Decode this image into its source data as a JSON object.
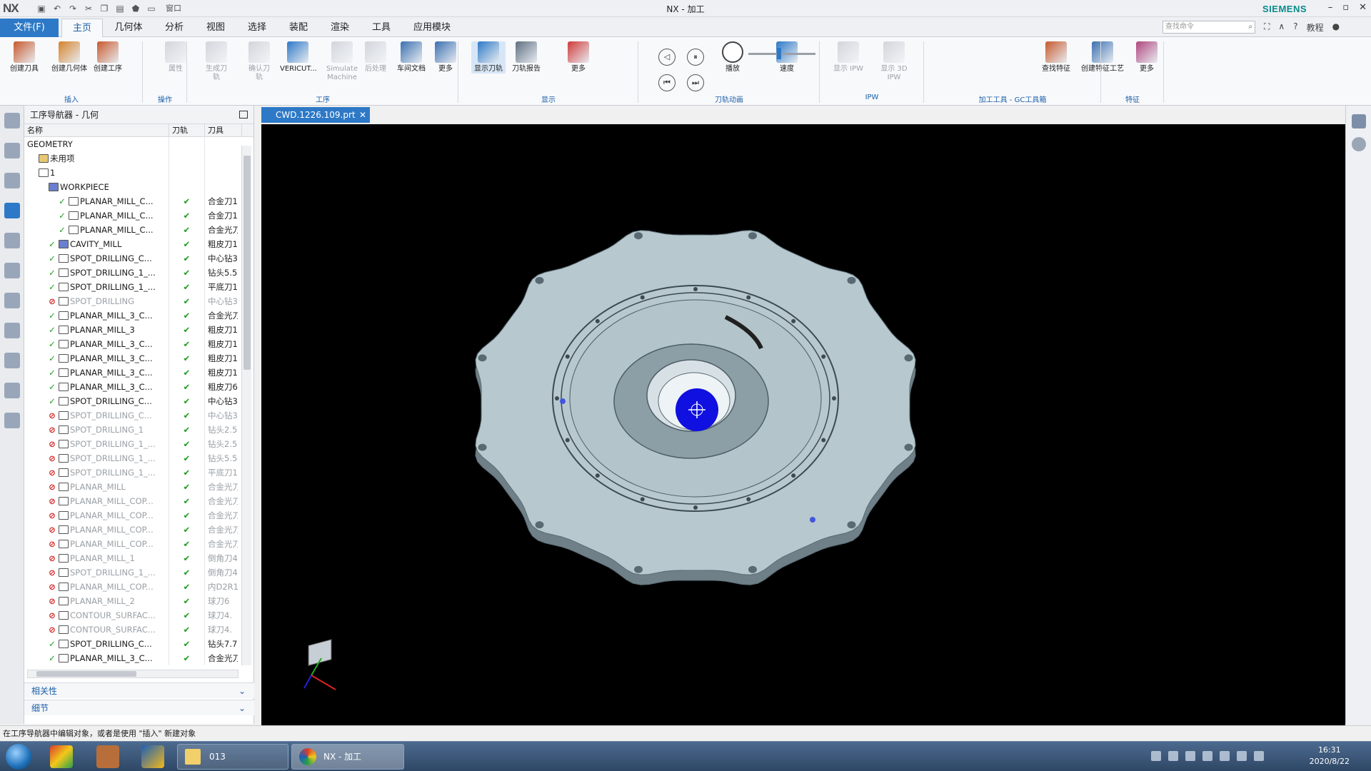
{
  "titlebar": {
    "logo": "NX",
    "title": "NX - 加工",
    "brand": "SIEMENS",
    "window_buttons": [
      "–",
      "▫",
      "✕"
    ],
    "quick_access_icons": [
      "save-icon",
      "undo-icon",
      "redo-icon",
      "cut-icon",
      "copy-icon",
      "paste-icon",
      "touch-mode-icon",
      "window-icon"
    ],
    "window_menu_label": "窗口"
  },
  "menu": {
    "file": "文件(F)",
    "tabs": [
      "主页",
      "几何体",
      "分析",
      "视图",
      "选择",
      "装配",
      "渲染",
      "工具",
      "应用模块"
    ],
    "active_tab": "主页",
    "search_placeholder": "查找命令",
    "tutorial": "教程"
  },
  "ribbon": {
    "buttons": [
      {
        "label": "创建刀具",
        "enabled": true,
        "color": "#c8592d"
      },
      {
        "label": "创建几何体",
        "enabled": true,
        "color": "#d6822a"
      },
      {
        "label": "创建工序",
        "enabled": true,
        "color": "#c8592d"
      },
      {
        "label": "属性",
        "enabled": false,
        "color": "#8a939e"
      },
      {
        "label": "生成刀轨",
        "enabled": false,
        "color": "#8a939e"
      },
      {
        "label": "确认刀轨",
        "enabled": false,
        "color": "#8a939e"
      },
      {
        "label": "VERICUT...",
        "enabled": true,
        "color": "#2d79c7"
      },
      {
        "label": "Simulate Machine",
        "enabled": false,
        "color": "#8a939e"
      },
      {
        "label": "后处理",
        "enabled": false,
        "color": "#8a939e"
      },
      {
        "label": "车间文档",
        "enabled": true,
        "color": "#3a6fb0"
      },
      {
        "label": "更多",
        "enabled": true,
        "color": "#3a6fb0"
      },
      {
        "label": "显示刀轨",
        "enabled": true,
        "color": "#2d79c7"
      },
      {
        "label": "刀轨报告",
        "enabled": true,
        "color": "#5e6e80"
      },
      {
        "label": "更多",
        "enabled": true,
        "color": "#d23a3a"
      },
      {
        "label": "播放",
        "enabled": true,
        "color": "#444"
      },
      {
        "label": "速度",
        "enabled": true,
        "color": "#2d79c7"
      },
      {
        "label": "显示 IPW",
        "enabled": false,
        "color": "#8a939e"
      },
      {
        "label": "显示 3D IPW",
        "enabled": false,
        "color": "#8a939e"
      },
      {
        "label": "查找特征",
        "enabled": true,
        "color": "#c8592d"
      },
      {
        "label": "创建特征工艺",
        "enabled": true,
        "color": "#3a6fb0"
      },
      {
        "label": "更多",
        "enabled": true,
        "color": "#b0467e"
      }
    ],
    "groups": [
      "插入",
      "操作",
      "工序",
      "显示",
      "刀轨动画",
      "IPW",
      "加工工具 - GC工具箱",
      "特征"
    ]
  },
  "navigator": {
    "title": "工序导航器 - 几何",
    "columns": [
      "名称",
      "刀轨",
      "刀具"
    ],
    "rows": [
      {
        "name": "GEOMETRY",
        "path": "",
        "tool": "",
        "status": "",
        "depth": 0,
        "icon": "none",
        "disabled": false
      },
      {
        "name": "未用项",
        "path": "",
        "tool": "",
        "status": "",
        "depth": 1,
        "icon": "folder",
        "disabled": false
      },
      {
        "name": "1",
        "path": "",
        "tool": "",
        "status": "",
        "depth": 1,
        "icon": "csys",
        "disabled": false
      },
      {
        "name": "WORKPIECE",
        "path": "",
        "tool": "",
        "status": "",
        "depth": 2,
        "icon": "workpiece",
        "disabled": false
      },
      {
        "name": "PLANAR_MILL_C...",
        "path": "✔",
        "tool": "合金刀1",
        "status": "ok",
        "depth": 3,
        "icon": "planar",
        "disabled": false
      },
      {
        "name": "PLANAR_MILL_C...",
        "path": "✔",
        "tool": "合金刀1",
        "status": "ok",
        "depth": 3,
        "icon": "planar",
        "disabled": false
      },
      {
        "name": "PLANAR_MILL_C...",
        "path": "✔",
        "tool": "合金光刀",
        "status": "ok",
        "depth": 3,
        "icon": "planar",
        "disabled": false
      },
      {
        "name": "CAVITY_MILL",
        "path": "✔",
        "tool": "粗皮刀1",
        "status": "ok",
        "depth": 2,
        "icon": "cavity",
        "disabled": false
      },
      {
        "name": "SPOT_DRILLING_C...",
        "path": "✔",
        "tool": "中心钻3",
        "status": "ok",
        "depth": 2,
        "icon": "drill",
        "disabled": false
      },
      {
        "name": "SPOT_DRILLING_1_...",
        "path": "✔",
        "tool": "钻头5.5",
        "status": "ok",
        "depth": 2,
        "icon": "drill",
        "disabled": false
      },
      {
        "name": "SPOT_DRILLING_1_...",
        "path": "✔",
        "tool": "平底刀1",
        "status": "ok",
        "depth": 2,
        "icon": "drill",
        "disabled": false
      },
      {
        "name": "SPOT_DRILLING",
        "path": "✔",
        "tool": "中心钻3",
        "status": "no",
        "depth": 2,
        "icon": "drill",
        "disabled": true
      },
      {
        "name": "PLANAR_MILL_3_C...",
        "path": "✔",
        "tool": "合金光刀",
        "status": "ok",
        "depth": 2,
        "icon": "planar",
        "disabled": false
      },
      {
        "name": "PLANAR_MILL_3",
        "path": "✔",
        "tool": "粗皮刀1",
        "status": "ok",
        "depth": 2,
        "icon": "planar",
        "disabled": false
      },
      {
        "name": "PLANAR_MILL_3_C...",
        "path": "✔",
        "tool": "粗皮刀1",
        "status": "ok",
        "depth": 2,
        "icon": "planar",
        "disabled": false
      },
      {
        "name": "PLANAR_MILL_3_C...",
        "path": "✔",
        "tool": "粗皮刀1",
        "status": "ok",
        "depth": 2,
        "icon": "planar",
        "disabled": false
      },
      {
        "name": "PLANAR_MILL_3_C...",
        "path": "✔",
        "tool": "粗皮刀1",
        "status": "ok",
        "depth": 2,
        "icon": "planar",
        "disabled": false
      },
      {
        "name": "PLANAR_MILL_3_C...",
        "path": "✔",
        "tool": "粗皮刀6",
        "status": "ok",
        "depth": 2,
        "icon": "planar",
        "disabled": false
      },
      {
        "name": "SPOT_DRILLING_C...",
        "path": "✔",
        "tool": "中心钻3",
        "status": "ok",
        "depth": 2,
        "icon": "drill",
        "disabled": false
      },
      {
        "name": "SPOT_DRILLING_C...",
        "path": "✔",
        "tool": "中心钻3",
        "status": "no",
        "depth": 2,
        "icon": "drill",
        "disabled": true
      },
      {
        "name": "SPOT_DRILLING_1",
        "path": "✔",
        "tool": "钻头2.5",
        "status": "no",
        "depth": 2,
        "icon": "drill",
        "disabled": true
      },
      {
        "name": "SPOT_DRILLING_1_...",
        "path": "✔",
        "tool": "钻头2.5",
        "status": "no",
        "depth": 2,
        "icon": "drill",
        "disabled": true
      },
      {
        "name": "SPOT_DRILLING_1_...",
        "path": "✔",
        "tool": "钻头5.5",
        "status": "no",
        "depth": 2,
        "icon": "drill",
        "disabled": true
      },
      {
        "name": "SPOT_DRILLING_1_...",
        "path": "✔",
        "tool": "平底刀1",
        "status": "no",
        "depth": 2,
        "icon": "drill",
        "disabled": true
      },
      {
        "name": "PLANAR_MILL",
        "path": "✔",
        "tool": "合金光刀",
        "status": "no",
        "depth": 2,
        "icon": "planar",
        "disabled": true
      },
      {
        "name": "PLANAR_MILL_COP...",
        "path": "✔",
        "tool": "合金光刀",
        "status": "no",
        "depth": 2,
        "icon": "planar",
        "disabled": true
      },
      {
        "name": "PLANAR_MILL_COP...",
        "path": "✔",
        "tool": "合金光刀",
        "status": "no",
        "depth": 2,
        "icon": "planar",
        "disabled": true
      },
      {
        "name": "PLANAR_MILL_COP...",
        "path": "✔",
        "tool": "合金光刀",
        "status": "no",
        "depth": 2,
        "icon": "planar",
        "disabled": true
      },
      {
        "name": "PLANAR_MILL_COP...",
        "path": "✔",
        "tool": "合金光刀",
        "status": "no",
        "depth": 2,
        "icon": "planar",
        "disabled": true
      },
      {
        "name": "PLANAR_MILL_1",
        "path": "✔",
        "tool": "倒角刀4",
        "status": "no",
        "depth": 2,
        "icon": "planar",
        "disabled": true
      },
      {
        "name": "SPOT_DRILLING_1_...",
        "path": "✔",
        "tool": "倒角刀4",
        "status": "no",
        "depth": 2,
        "icon": "drill",
        "disabled": true
      },
      {
        "name": "PLANAR_MILL_COP...",
        "path": "✔",
        "tool": "内D2R1",
        "status": "no",
        "depth": 2,
        "icon": "planar",
        "disabled": true
      },
      {
        "name": "PLANAR_MILL_2",
        "path": "✔",
        "tool": "球刀6",
        "status": "no",
        "depth": 2,
        "icon": "planar",
        "disabled": true
      },
      {
        "name": "CONTOUR_SURFAC...",
        "path": "✔",
        "tool": "球刀4.",
        "status": "no",
        "depth": 2,
        "icon": "contour",
        "disabled": true
      },
      {
        "name": "CONTOUR_SURFAC...",
        "path": "✔",
        "tool": "球刀4.",
        "status": "no",
        "depth": 2,
        "icon": "contour",
        "disabled": true
      },
      {
        "name": "SPOT_DRILLING_C...",
        "path": "✔",
        "tool": "钻头7.7",
        "status": "ok",
        "depth": 2,
        "icon": "drill",
        "disabled": false
      },
      {
        "name": "PLANAR_MILL_3_C...",
        "path": "✔",
        "tool": "合金光刀",
        "status": "ok",
        "depth": 2,
        "icon": "planar",
        "disabled": false
      }
    ],
    "panels": [
      "相关性",
      "细节"
    ]
  },
  "document_tab": {
    "label": "CWD.1226.109.prt"
  },
  "viewport": {
    "background": "#000000",
    "part_color": "#b7c8cf",
    "part_edge_color": "#5a6b72",
    "hole_count": 12,
    "highlight_color": "#1010e0"
  },
  "status_bar": {
    "message": "在工序导航器中编辑对象，或者是使用 \"插入\" 新建对象"
  },
  "taskbar": {
    "tasks": [
      {
        "label": "013",
        "active": false
      },
      {
        "label": "NX - 加工",
        "active": true
      }
    ],
    "time": "16:31",
    "date": "2020/8/22"
  }
}
